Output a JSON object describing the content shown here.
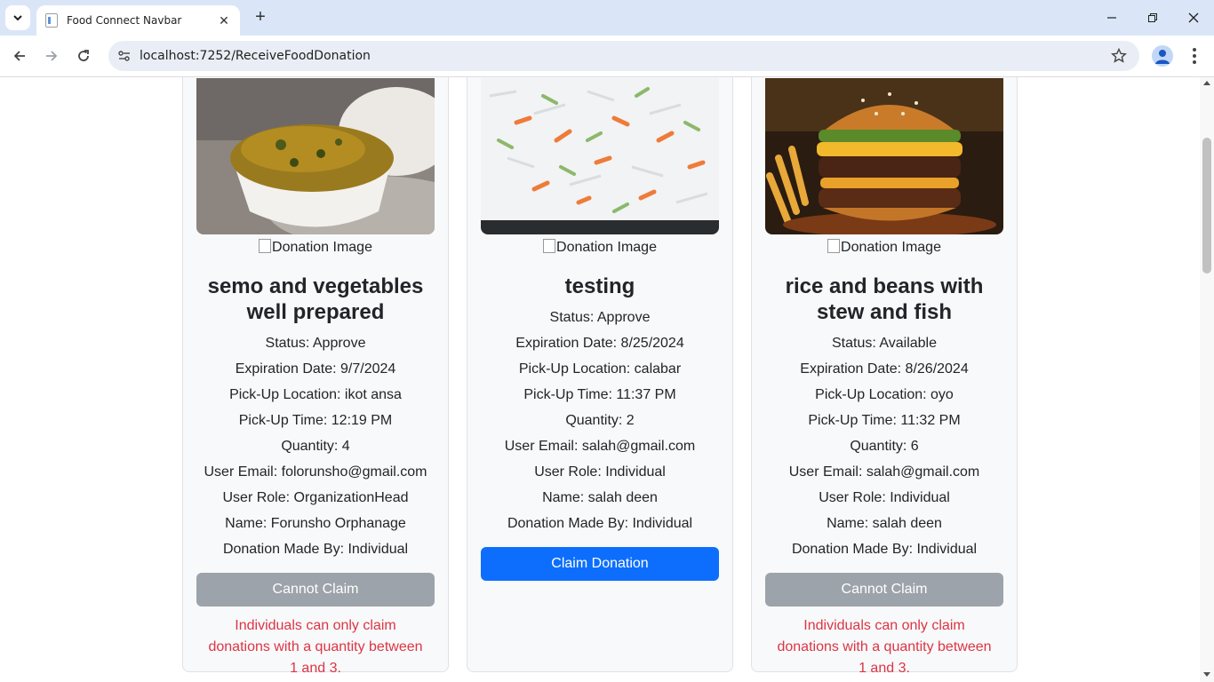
{
  "browser": {
    "tab_title": "Food Connect Navbar",
    "url": "localhost:7252/ReceiveFoodDonation"
  },
  "alt_text": "Donation Image",
  "colors": {
    "primary": "#0d6efd",
    "disabled": "#9da3aa",
    "danger": "#dc3545"
  },
  "cards": [
    {
      "title": "semo and vegetables well prepared",
      "status": "Status: Approve",
      "expiration": "Expiration Date: 9/7/2024",
      "location": "Pick-Up Location: ikot ansa",
      "time": "Pick-Up Time: 12:19 PM",
      "quantity": "Quantity: 4",
      "email": "User Email: folorunsho@gmail.com",
      "role": "User Role: OrganizationHead",
      "name": "Name: Forunsho Orphanage",
      "made_by": "Donation Made By: Individual",
      "button": "Cannot Claim",
      "message": "Individuals can only claim donations with a quantity between 1 and 3."
    },
    {
      "title": "testing",
      "status": "Status: Approve",
      "expiration": "Expiration Date: 8/25/2024",
      "location": "Pick-Up Location: calabar",
      "time": "Pick-Up Time: 11:37 PM",
      "quantity": "Quantity: 2",
      "email": "User Email: salah@gmail.com",
      "role": "User Role: Individual",
      "name": "Name: salah deen",
      "made_by": "Donation Made By: Individual",
      "button": "Claim Donation"
    },
    {
      "title": "rice and beans with stew and fish",
      "status": "Status: Available",
      "expiration": "Expiration Date: 8/26/2024",
      "location": "Pick-Up Location: oyo",
      "time": "Pick-Up Time: 11:32 PM",
      "quantity": "Quantity: 6",
      "email": "User Email: salah@gmail.com",
      "role": "User Role: Individual",
      "name": "Name: salah deen",
      "made_by": "Donation Made By: Individual",
      "button": "Cannot Claim",
      "message": "Individuals can only claim donations with a quantity between 1 and 3."
    }
  ]
}
